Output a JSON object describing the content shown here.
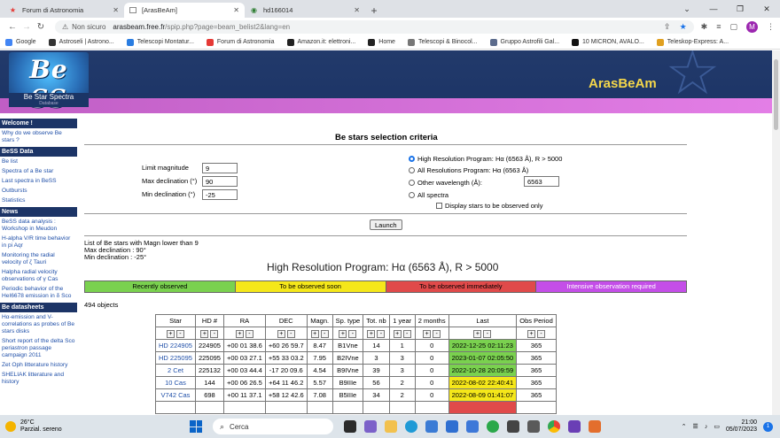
{
  "browser": {
    "tabs": [
      {
        "title": "Forum di Astronomia",
        "active": false
      },
      {
        "title": "[ArasBeAm]",
        "active": true
      },
      {
        "title": "hd166014",
        "active": false
      }
    ],
    "address": {
      "warning": "Non sicuro",
      "host": "arasbeam.free.fr",
      "path": "/spip.php?page=beam_belist2&lang=en"
    },
    "bookmarks": [
      {
        "label": "Google",
        "color": "#4285f4"
      },
      {
        "label": "Astroseli | Astrono...",
        "color": "#333333"
      },
      {
        "label": "Telescopi Montatur...",
        "color": "#2a7de1"
      },
      {
        "label": "Forum di Astronomia",
        "color": "#e53935"
      },
      {
        "label": "Amazon.it: elettroni...",
        "color": "#222222"
      },
      {
        "label": "Home",
        "color": "#222222"
      },
      {
        "label": "Telescopi & Binocol...",
        "color": "#777777"
      },
      {
        "label": "Gruppo Astrofili Gal...",
        "color": "#5b6b8c"
      },
      {
        "label": "10 MICRON, AVALO...",
        "color": "#111111"
      },
      {
        "label": "Teleskop-Express: A...",
        "color": "#e0a020"
      }
    ]
  },
  "banner": {
    "logo_text": "Be SS",
    "logo_sub": "Be Star Spectra",
    "logo_small": "Database",
    "site_name": "ArasBeAm"
  },
  "sidebar": [
    {
      "type": "head",
      "text": "Welcome !"
    },
    {
      "type": "link",
      "text": "Why do we observe Be stars ?"
    },
    {
      "type": "head",
      "text": "BeSS Data"
    },
    {
      "type": "link",
      "text": "Be list"
    },
    {
      "type": "link",
      "text": "Spectra of a Be star"
    },
    {
      "type": "link",
      "text": "Last spectra in BeSS"
    },
    {
      "type": "link",
      "text": "Outbursts"
    },
    {
      "type": "link",
      "text": "Statistics"
    },
    {
      "type": "head",
      "text": "News"
    },
    {
      "type": "link",
      "text": "BeSS data analysis : Workshop in Meudon"
    },
    {
      "type": "link",
      "text": "H-alpha V/R time behavior in pi Aqr"
    },
    {
      "type": "link",
      "text": "Monitoring the radial velocity of ζ Tauri"
    },
    {
      "type": "link",
      "text": "Halpha radial velocity observations of γ Cas"
    },
    {
      "type": "link",
      "text": "Periodic behavior of the HeI6678 emission in δ Sco"
    },
    {
      "type": "head",
      "text": "Be datasheets"
    },
    {
      "type": "link",
      "text": "Hα-emission and V-correlations as probes of Be stars disks"
    },
    {
      "type": "link",
      "text": "Short report of the delta Sco periastron passage campaign 2011"
    },
    {
      "type": "link",
      "text": "Zet Oph litterature history"
    },
    {
      "type": "link",
      "text": "SHELIAK litterature and history"
    }
  ],
  "criteria": {
    "title": "Be stars selection criteria",
    "limit_mag_label": "Limit magnitude",
    "limit_mag": "9",
    "max_dec_label": "Max declination (°)",
    "max_dec": "90",
    "min_dec_label": "Min declination (°)",
    "min_dec": "-25",
    "opt_high": "High Resolution Program: Hα (6563 Å), R > 5000",
    "opt_all": "All Resolutions Program: Hα (6563 Å)",
    "opt_other": "Other wavelength (Å):",
    "other_wl": "6563",
    "opt_spectra": "All spectra",
    "display_obs": "Display stars to be observed only",
    "launch": "Launch"
  },
  "results": {
    "list_line": "List of Be stars with Magn lower than 9",
    "max_line": "Max declination : 90°",
    "min_line": "Min declination : -25°",
    "program_title": "High Resolution Program: Hα (6563 Å), R > 5000",
    "legend": [
      {
        "text": "Recently observed",
        "color": "#7ad14f",
        "text_color": "#000000"
      },
      {
        "text": "To be observed soon",
        "color": "#f5e71a",
        "text_color": "#000000"
      },
      {
        "text": "To be observed immediately",
        "color": "#e04a4a",
        "text_color": "#000000"
      },
      {
        "text": "Intensive observation required",
        "color": "#c44ee8",
        "text_color": "#ffffff"
      }
    ],
    "count": "494 objects",
    "columns": [
      "Star",
      "HD #",
      "RA",
      "DEC",
      "Magn.",
      "Sp. type",
      "Tot. nb",
      "1 year",
      "2 months",
      "Last",
      "Obs Period"
    ],
    "rows": [
      [
        "HD 224905",
        "224905",
        "+00 01 38.6",
        "+60 26 59.7",
        "8.47",
        "B1Vne",
        "14",
        "1",
        "0",
        "2022-12-25 02:11:23",
        "365",
        "g"
      ],
      [
        "HD 225095",
        "225095",
        "+00 03 27.1",
        "+55 33 03.2",
        "7.95",
        "B2IVne",
        "3",
        "3",
        "0",
        "2023-01-07 02:05:50",
        "365",
        "g"
      ],
      [
        "2 Cet",
        "225132",
        "+00 03 44.4",
        "-17 20 09.6",
        "4.54",
        "B9IVne",
        "39",
        "3",
        "0",
        "2022-10-28 20:09:59",
        "365",
        "g"
      ],
      [
        "10 Cas",
        "144",
        "+00 06 26.5",
        "+64 11 46.2",
        "5.57",
        "B9IIIe",
        "56",
        "2",
        "0",
        "2022-08-02 22:40:41",
        "365",
        "y"
      ],
      [
        "V742 Cas",
        "698",
        "+00 11 37.1",
        "+58 12 42.6",
        "7.08",
        "B5IIIe",
        "34",
        "2",
        "0",
        "2022-08-09 01:41:07",
        "365",
        "y"
      ],
      [
        "",
        "",
        "",
        "",
        "",
        "",
        "",
        "",
        "",
        "",
        "",
        "r"
      ]
    ]
  },
  "taskbar": {
    "temp": "26°C",
    "weather": "Parzial. sereno",
    "search": "Cerca",
    "time": "21:00",
    "date": "05/07/2023",
    "notif": "1"
  }
}
